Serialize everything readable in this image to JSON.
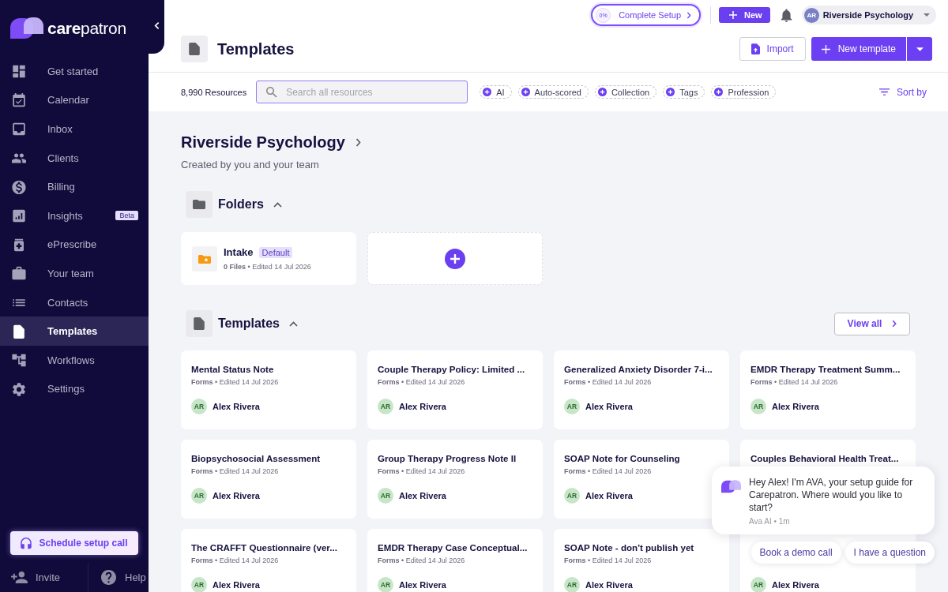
{
  "sidebar": {
    "logo": "**care**patron",
    "items": [
      {
        "label": "Get started",
        "selected": false
      },
      {
        "label": "Calendar",
        "selected": false
      },
      {
        "label": "Inbox",
        "selected": false
      },
      {
        "label": "Clients",
        "selected": false
      },
      {
        "label": "Billing",
        "selected": false
      },
      {
        "label": "Insights",
        "selected": false,
        "badge": "Beta"
      },
      {
        "label": "ePrescribe",
        "selected": false
      },
      {
        "label": "Your team",
        "selected": false
      },
      {
        "label": "Contacts",
        "selected": false
      },
      {
        "label": "Templates",
        "selected": true
      },
      {
        "label": "Workflows",
        "selected": false
      },
      {
        "label": "Settings",
        "selected": false
      }
    ],
    "setup_call_button": "Schedule setup call",
    "footer": [
      "Invite",
      "Help"
    ]
  },
  "topbar": {
    "setup_progress": {
      "label": "0%",
      "level": 0
    },
    "setup_button": "Complete Setup",
    "new_button": "New",
    "account": {
      "initials": "AR",
      "name": "Riverside Psychology"
    }
  },
  "page_header": {
    "title": "Templates",
    "import_button": "Import",
    "new_template_button": "New template"
  },
  "filter_bar": {
    "count": "8,990 Resources",
    "search": {
      "placeholder": "Search all resources"
    },
    "chips": [
      "AI",
      "Auto-scored",
      "Collection",
      "Tags",
      "Profession"
    ],
    "sort_button": "Sort by"
  },
  "workspace": {
    "title": "Riverside Psychology",
    "subtitle": "Created by you and your team"
  },
  "folders": {
    "heading": "Folders",
    "expanded": true,
    "items": [
      {
        "name": "Intake",
        "badge": "Default",
        "meta": "**0 Files** • Edited 14 Jul 2026"
      }
    ]
  },
  "templates": {
    "heading": "Templates",
    "expanded": true,
    "view_all_button": "View all",
    "items": [
      {
        "title": "Mental Status Note",
        "meta": "**Forms** • Edited 14 Jul 2026",
        "author": {
          "initials": "AR",
          "name": "Alex Rivera"
        }
      },
      {
        "title": "Couple Therapy Policy: Limited ...",
        "meta": "**Forms** • Edited 14 Jul 2026",
        "author": {
          "initials": "AR",
          "name": "Alex Rivera"
        }
      },
      {
        "title": "Generalized Anxiety Disorder 7-i...",
        "meta": "**Forms** • Edited 14 Jul 2026",
        "author": {
          "initials": "AR",
          "name": "Alex Rivera"
        }
      },
      {
        "title": "EMDR Therapy Treatment Summ...",
        "meta": "**Forms** • Edited 14 Jul 2026",
        "author": {
          "initials": "AR",
          "name": "Alex Rivera"
        }
      },
      {
        "title": "Biopsychosocial Assessment",
        "meta": "**Forms** • Edited 14 Jul 2026",
        "author": {
          "initials": "AR",
          "name": "Alex Rivera"
        }
      },
      {
        "title": "Group Therapy Progress Note II",
        "meta": "**Forms** • Edited 14 Jul 2026",
        "author": {
          "initials": "AR",
          "name": "Alex Rivera"
        }
      },
      {
        "title": "SOAP Note for Counseling",
        "meta": "**Forms** • Edited 14 Jul 2026",
        "author": {
          "initials": "AR",
          "name": "Alex Rivera"
        }
      },
      {
        "title": "Couples Behavioral Health Treat..."
      },
      {
        "title": "The CRAFFT Questionnaire (ver...",
        "meta": "**Forms** • Edited 14 Jul 2026",
        "author": {
          "initials": "AR",
          "name": "Alex Rivera"
        }
      },
      {
        "title": "EMDR Therapy Case Conceptual...",
        "meta": "**Forms** • Edited 14 Jul 2026",
        "author": {
          "initials": "AR",
          "name": "Alex Rivera"
        }
      },
      {
        "title": "SOAP Note - don't publish yet",
        "meta": "**Forms** • Edited 14 Jul 2026",
        "author": {
          "initials": "AR",
          "name": "Alex Rivera"
        }
      },
      {
        "author": {
          "initials": "AR",
          "name": "Alex Rivera"
        }
      }
    ]
  },
  "chat": {
    "message": "Hey Alex! I'm AVA, your setup guide for Carepatron. Where would you like to start?",
    "meta": "Ava AI • 1m",
    "replies": [
      "Book a demo call",
      "I have a question"
    ]
  }
}
